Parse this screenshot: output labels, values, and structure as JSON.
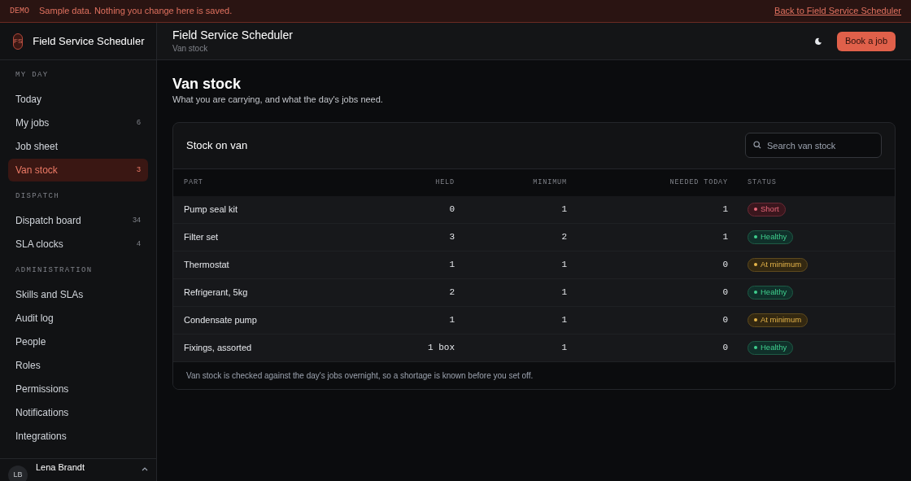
{
  "banner": {
    "tag": "DEMO",
    "message": "Sample data. Nothing you change here is saved.",
    "link": "Back to Field Service Scheduler"
  },
  "sidebar": {
    "logo": "FS",
    "app_name": "Field Service Scheduler",
    "sections": [
      {
        "title": "MY DAY",
        "items": [
          {
            "label": "Today",
            "selected": false
          },
          {
            "label": "My jobs",
            "count": "6",
            "selected": false
          },
          {
            "label": "Job sheet",
            "selected": false
          },
          {
            "label": "Van stock",
            "count": "3",
            "selected": true
          }
        ]
      },
      {
        "title": "DISPATCH",
        "items": [
          {
            "label": "Dispatch board",
            "count": "34",
            "selected": false
          },
          {
            "label": "SLA clocks",
            "count": "4",
            "selected": false
          }
        ]
      },
      {
        "title": "ADMINISTRATION",
        "items": [
          {
            "label": "Skills and SLAs",
            "selected": false
          },
          {
            "label": "Audit log",
            "selected": false
          },
          {
            "label": "People",
            "selected": false
          },
          {
            "label": "Roles",
            "selected": false
          },
          {
            "label": "Permissions",
            "selected": false
          },
          {
            "label": "Notifications",
            "selected": false
          },
          {
            "label": "Integrations",
            "selected": false
          }
        ]
      }
    ],
    "user": {
      "initials": "LB",
      "name": "Lena Brandt"
    }
  },
  "header": {
    "title": "Field Service Scheduler",
    "breadcrumb": "Van stock",
    "button": "Book a job"
  },
  "page": {
    "title": "Van stock",
    "subtitle": "What you are carrying, and what the day's jobs need."
  },
  "card": {
    "title": "Stock on van",
    "search": {
      "placeholder": "Search van stock"
    },
    "table": {
      "columns": [
        "PART",
        "HELD",
        "MINIMUM",
        "NEEDED TODAY",
        "STATUS"
      ],
      "rows": [
        {
          "part": "Pump seal kit",
          "held": "0",
          "minimum": "1",
          "needed": "1",
          "status": {
            "label": "Short",
            "kind": "short"
          }
        },
        {
          "part": "Filter set",
          "held": "3",
          "minimum": "2",
          "needed": "1",
          "status": {
            "label": "Healthy",
            "kind": "healthy"
          }
        },
        {
          "part": "Thermostat",
          "held": "1",
          "minimum": "1",
          "needed": "0",
          "status": {
            "label": "At minimum",
            "kind": "minimum"
          }
        },
        {
          "part": "Refrigerant, 5kg",
          "held": "2",
          "minimum": "1",
          "needed": "0",
          "status": {
            "label": "Healthy",
            "kind": "healthy"
          }
        },
        {
          "part": "Condensate pump",
          "held": "1",
          "minimum": "1",
          "needed": "0",
          "status": {
            "label": "At minimum",
            "kind": "minimum"
          }
        },
        {
          "part": "Fixings, assorted",
          "held": "1 box",
          "minimum": "1",
          "needed": "0",
          "status": {
            "label": "Healthy",
            "kind": "healthy"
          }
        }
      ]
    },
    "footnote": "Van stock is checked against the day's jobs overnight, so a shortage is known before you set off."
  }
}
